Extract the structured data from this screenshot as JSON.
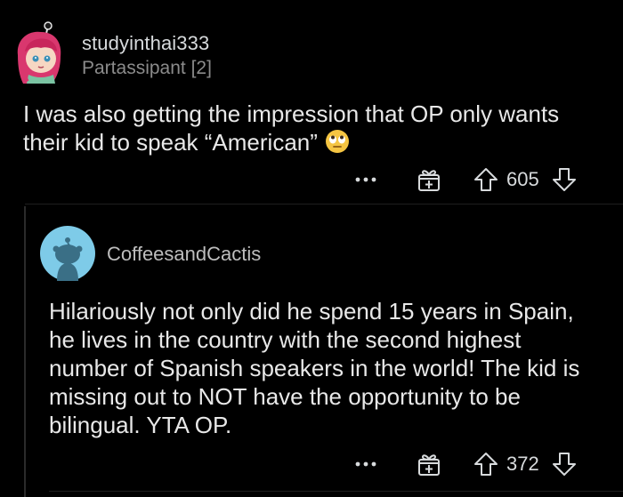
{
  "comment1": {
    "username": "studyinthai333",
    "flair": "Partassipant [2]",
    "body": "I was also getting the impression that OP only wants their kid to speak “American”",
    "emoji": "rolling-eyes-emoji",
    "score": "605",
    "more_label": "•••"
  },
  "comment2": {
    "username": "CoffeesandCactis",
    "body": "Hilariously not only did he spend 15 years in Spain, he lives in the country with the second highest number of Spanish speakers in the world! The kid is missing out to NOT have the opportunity to be bilingual. YTA OP.",
    "score": "372",
    "more_label": "•••"
  },
  "colors": {
    "background": "#000000",
    "text": "#e8e8e8",
    "muted": "#8b8b8b",
    "icon": "#d7dadc",
    "avatar2_bg": "#7ecbe8"
  },
  "icons": [
    "more-options-icon",
    "award-gift-icon",
    "upvote-icon",
    "downvote-icon"
  ]
}
